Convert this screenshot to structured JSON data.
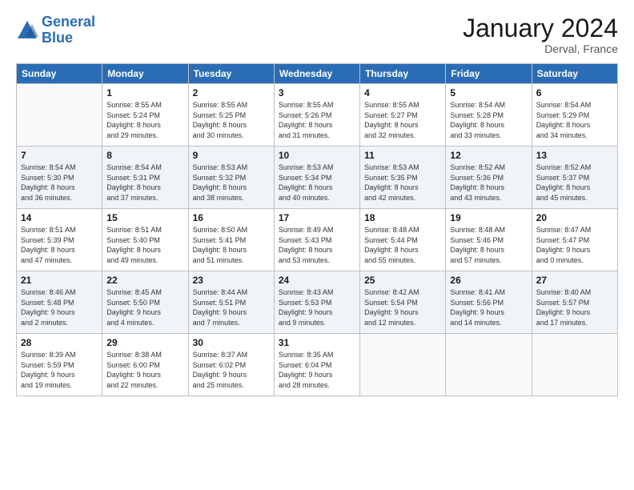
{
  "header": {
    "logo_line1": "General",
    "logo_line2": "Blue",
    "month_title": "January 2024",
    "location": "Derval, France"
  },
  "weekdays": [
    "Sunday",
    "Monday",
    "Tuesday",
    "Wednesday",
    "Thursday",
    "Friday",
    "Saturday"
  ],
  "rows": [
    [
      {
        "day": "",
        "info": ""
      },
      {
        "day": "1",
        "info": "Sunrise: 8:55 AM\nSunset: 5:24 PM\nDaylight: 8 hours\nand 29 minutes."
      },
      {
        "day": "2",
        "info": "Sunrise: 8:55 AM\nSunset: 5:25 PM\nDaylight: 8 hours\nand 30 minutes."
      },
      {
        "day": "3",
        "info": "Sunrise: 8:55 AM\nSunset: 5:26 PM\nDaylight: 8 hours\nand 31 minutes."
      },
      {
        "day": "4",
        "info": "Sunrise: 8:55 AM\nSunset: 5:27 PM\nDaylight: 8 hours\nand 32 minutes."
      },
      {
        "day": "5",
        "info": "Sunrise: 8:54 AM\nSunset: 5:28 PM\nDaylight: 8 hours\nand 33 minutes."
      },
      {
        "day": "6",
        "info": "Sunrise: 8:54 AM\nSunset: 5:29 PM\nDaylight: 8 hours\nand 34 minutes."
      }
    ],
    [
      {
        "day": "7",
        "info": "Sunrise: 8:54 AM\nSunset: 5:30 PM\nDaylight: 8 hours\nand 36 minutes."
      },
      {
        "day": "8",
        "info": "Sunrise: 8:54 AM\nSunset: 5:31 PM\nDaylight: 8 hours\nand 37 minutes."
      },
      {
        "day": "9",
        "info": "Sunrise: 8:53 AM\nSunset: 5:32 PM\nDaylight: 8 hours\nand 38 minutes."
      },
      {
        "day": "10",
        "info": "Sunrise: 8:53 AM\nSunset: 5:34 PM\nDaylight: 8 hours\nand 40 minutes."
      },
      {
        "day": "11",
        "info": "Sunrise: 8:53 AM\nSunset: 5:35 PM\nDaylight: 8 hours\nand 42 minutes."
      },
      {
        "day": "12",
        "info": "Sunrise: 8:52 AM\nSunset: 5:36 PM\nDaylight: 8 hours\nand 43 minutes."
      },
      {
        "day": "13",
        "info": "Sunrise: 8:52 AM\nSunset: 5:37 PM\nDaylight: 8 hours\nand 45 minutes."
      }
    ],
    [
      {
        "day": "14",
        "info": "Sunrise: 8:51 AM\nSunset: 5:39 PM\nDaylight: 8 hours\nand 47 minutes."
      },
      {
        "day": "15",
        "info": "Sunrise: 8:51 AM\nSunset: 5:40 PM\nDaylight: 8 hours\nand 49 minutes."
      },
      {
        "day": "16",
        "info": "Sunrise: 8:50 AM\nSunset: 5:41 PM\nDaylight: 8 hours\nand 51 minutes."
      },
      {
        "day": "17",
        "info": "Sunrise: 8:49 AM\nSunset: 5:43 PM\nDaylight: 8 hours\nand 53 minutes."
      },
      {
        "day": "18",
        "info": "Sunrise: 8:48 AM\nSunset: 5:44 PM\nDaylight: 8 hours\nand 55 minutes."
      },
      {
        "day": "19",
        "info": "Sunrise: 8:48 AM\nSunset: 5:46 PM\nDaylight: 8 hours\nand 57 minutes."
      },
      {
        "day": "20",
        "info": "Sunrise: 8:47 AM\nSunset: 5:47 PM\nDaylight: 9 hours\nand 0 minutes."
      }
    ],
    [
      {
        "day": "21",
        "info": "Sunrise: 8:46 AM\nSunset: 5:48 PM\nDaylight: 9 hours\nand 2 minutes."
      },
      {
        "day": "22",
        "info": "Sunrise: 8:45 AM\nSunset: 5:50 PM\nDaylight: 9 hours\nand 4 minutes."
      },
      {
        "day": "23",
        "info": "Sunrise: 8:44 AM\nSunset: 5:51 PM\nDaylight: 9 hours\nand 7 minutes."
      },
      {
        "day": "24",
        "info": "Sunrise: 8:43 AM\nSunset: 5:53 PM\nDaylight: 9 hours\nand 9 minutes."
      },
      {
        "day": "25",
        "info": "Sunrise: 8:42 AM\nSunset: 5:54 PM\nDaylight: 9 hours\nand 12 minutes."
      },
      {
        "day": "26",
        "info": "Sunrise: 8:41 AM\nSunset: 5:56 PM\nDaylight: 9 hours\nand 14 minutes."
      },
      {
        "day": "27",
        "info": "Sunrise: 8:40 AM\nSunset: 5:57 PM\nDaylight: 9 hours\nand 17 minutes."
      }
    ],
    [
      {
        "day": "28",
        "info": "Sunrise: 8:39 AM\nSunset: 5:59 PM\nDaylight: 9 hours\nand 19 minutes."
      },
      {
        "day": "29",
        "info": "Sunrise: 8:38 AM\nSunset: 6:00 PM\nDaylight: 9 hours\nand 22 minutes."
      },
      {
        "day": "30",
        "info": "Sunrise: 8:37 AM\nSunset: 6:02 PM\nDaylight: 9 hours\nand 25 minutes."
      },
      {
        "day": "31",
        "info": "Sunrise: 8:35 AM\nSunset: 6:04 PM\nDaylight: 9 hours\nand 28 minutes."
      },
      {
        "day": "",
        "info": ""
      },
      {
        "day": "",
        "info": ""
      },
      {
        "day": "",
        "info": ""
      }
    ]
  ]
}
